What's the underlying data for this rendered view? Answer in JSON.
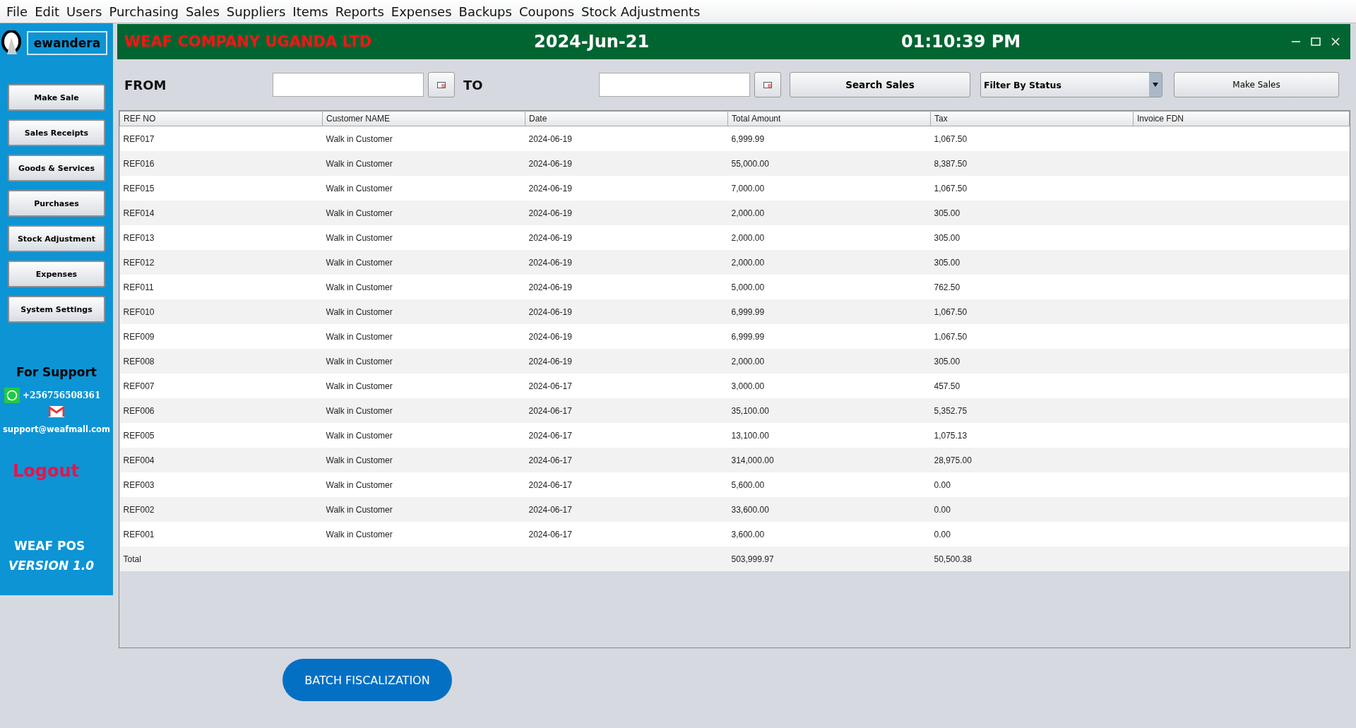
{
  "menu": [
    "File",
    "Edit",
    "Users",
    "Purchasing",
    "Sales",
    "Suppliers",
    "Items",
    "Reports",
    "Expenses",
    "Backups",
    "Coupons",
    "Stock Adjustments"
  ],
  "sidebar": {
    "user": "ewandera",
    "buttons": [
      "Make  Sale",
      "Sales Receipts",
      "Goods & Services",
      "Purchases",
      "Stock Adjustment",
      "Expenses",
      "System Settings"
    ],
    "support_title": "For Support",
    "phone": "+256756508361",
    "email": "support@weafmall.com",
    "logout": "Logout",
    "product": "WEAF POS",
    "version": "VERSION 1.0"
  },
  "header": {
    "company": "WEAF COMPANY UGANDA LTD",
    "date": "2024-Jun-21",
    "time": "01:10:39 PM"
  },
  "filters": {
    "from_label": "FROM",
    "to_label": "TO",
    "search_button": "Search Sales",
    "status_filter": "Filter By Status",
    "make_sales_button": "Make Sales"
  },
  "table": {
    "columns": [
      "REF NO",
      "Customer NAME",
      "Date",
      "Total Amount",
      "Tax",
      "Invoice FDN"
    ],
    "rows": [
      [
        "REF017",
        "Walk in Customer",
        "2024-06-19",
        "6,999.99",
        "1,067.50"
      ],
      [
        "REF016",
        "Walk in Customer",
        "2024-06-19",
        "55,000.00",
        "8,387.50"
      ],
      [
        "REF015",
        "Walk in Customer",
        "2024-06-19",
        "7,000.00",
        "1,067.50"
      ],
      [
        "REF014",
        "Walk in Customer",
        "2024-06-19",
        "2,000.00",
        "305.00"
      ],
      [
        "REF013",
        "Walk in Customer",
        "2024-06-19",
        "2,000.00",
        "305.00"
      ],
      [
        "REF012",
        "Walk in Customer",
        "2024-06-19",
        "2,000.00",
        "305.00"
      ],
      [
        "REF011",
        "Walk in Customer",
        "2024-06-19",
        "5,000.00",
        "762.50"
      ],
      [
        "REF010",
        "Walk in Customer",
        "2024-06-19",
        "6,999.99",
        "1,067.50"
      ],
      [
        "REF009",
        "Walk in Customer",
        "2024-06-19",
        "6,999.99",
        "1,067.50"
      ],
      [
        "REF008",
        "Walk in Customer",
        "2024-06-19",
        "2,000.00",
        "305.00"
      ],
      [
        "REF007",
        "Walk in Customer",
        "2024-06-17",
        "3,000.00",
        "457.50"
      ],
      [
        "REF006",
        "Walk in Customer",
        "2024-06-17",
        "35,100.00",
        "5,352.75"
      ],
      [
        "REF005",
        "Walk in Customer",
        "2024-06-17",
        "13,100.00",
        "1,075.13"
      ],
      [
        "REF004",
        "Walk in Customer",
        "2024-06-17",
        "314,000.00",
        "28,975.00"
      ],
      [
        "REF003",
        "Walk in Customer",
        "2024-06-17",
        "5,600.00",
        "0.00"
      ],
      [
        "REF002",
        "Walk in Customer",
        "2024-06-17",
        "33,600.00",
        "0.00"
      ],
      [
        "REF001",
        "Walk in Customer",
        "2024-06-17",
        "3,600.00",
        "0.00"
      ],
      [
        "Total",
        "",
        "",
        "503,999.97",
        "50,500.38"
      ]
    ]
  },
  "batch_button": "BATCH FISCALIZATION"
}
